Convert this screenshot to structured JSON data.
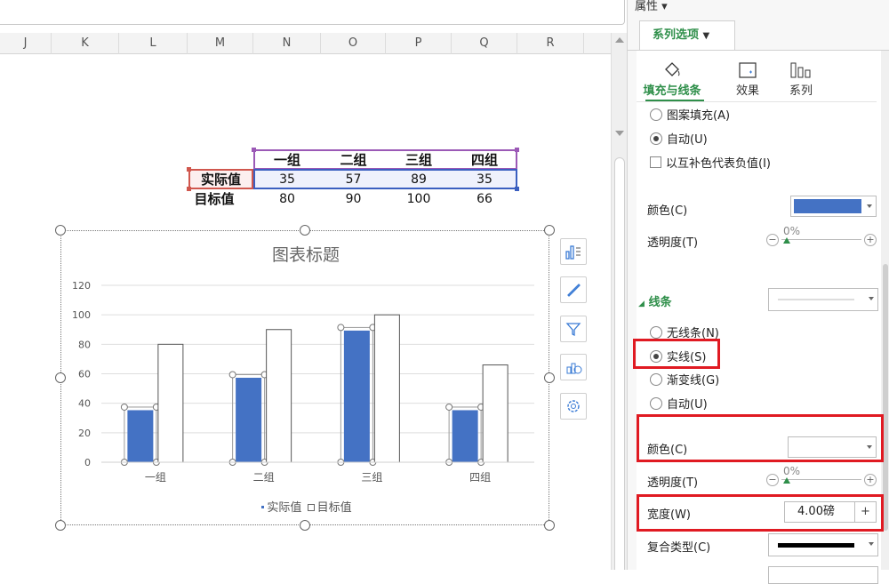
{
  "sheet": {
    "columns": [
      "J",
      "K",
      "L",
      "M",
      "N",
      "O",
      "P",
      "Q",
      "R"
    ],
    "table": {
      "categories": [
        "一组",
        "二组",
        "三组",
        "四组"
      ],
      "rows": [
        {
          "label": "实际值",
          "values": [
            "35",
            "57",
            "89",
            "35"
          ]
        },
        {
          "label": "目标值",
          "values": [
            "80",
            "90",
            "100",
            "66"
          ]
        }
      ]
    }
  },
  "chart_data": {
    "type": "bar",
    "title": "图表标题",
    "categories": [
      "一组",
      "二组",
      "三组",
      "四组"
    ],
    "series": [
      {
        "name": "实际值",
        "values": [
          35,
          57,
          89,
          35
        ],
        "color": "#4472c4",
        "selected": true
      },
      {
        "name": "目标值",
        "values": [
          80,
          90,
          100,
          66
        ],
        "color": "#ffffff",
        "border": "#555555"
      }
    ],
    "ylim": [
      0,
      120
    ],
    "yticks": [
      0,
      20,
      40,
      60,
      80,
      100,
      120
    ],
    "grid": true,
    "legend_position": "bottom"
  },
  "chart_buttons": [
    "chart-elements-icon",
    "chart-style-icon",
    "chart-filter-icon",
    "chart-map-icon",
    "chart-settings-icon"
  ],
  "pane": {
    "title": "属性",
    "tab": "系列选项",
    "subtabs": [
      "填充与线条",
      "效果",
      "系列"
    ],
    "fill_options": {
      "pattern": "图案填充(A)",
      "auto": "自动(U)",
      "invert": "以互补色代表负值(I)"
    },
    "fill_color_label": "颜色(C)",
    "fill_color": "#4472c4",
    "fill_transparency_label": "透明度(T)",
    "fill_transparency": "0%",
    "line_section": "线条",
    "line_options": {
      "none": "无线条(N)",
      "solid": "实线(S)",
      "gradient": "渐变线(G)",
      "auto": "自动(U)"
    },
    "line_color_label": "颜色(C)",
    "line_color": "#ffffff",
    "line_transparency_label": "透明度(T)",
    "line_transparency": "0%",
    "width_label": "宽度(W)",
    "width_value": "4.00磅",
    "compound_label": "复合类型(C)",
    "accent": "#2f8f4a",
    "highlight": "#e01a22"
  }
}
